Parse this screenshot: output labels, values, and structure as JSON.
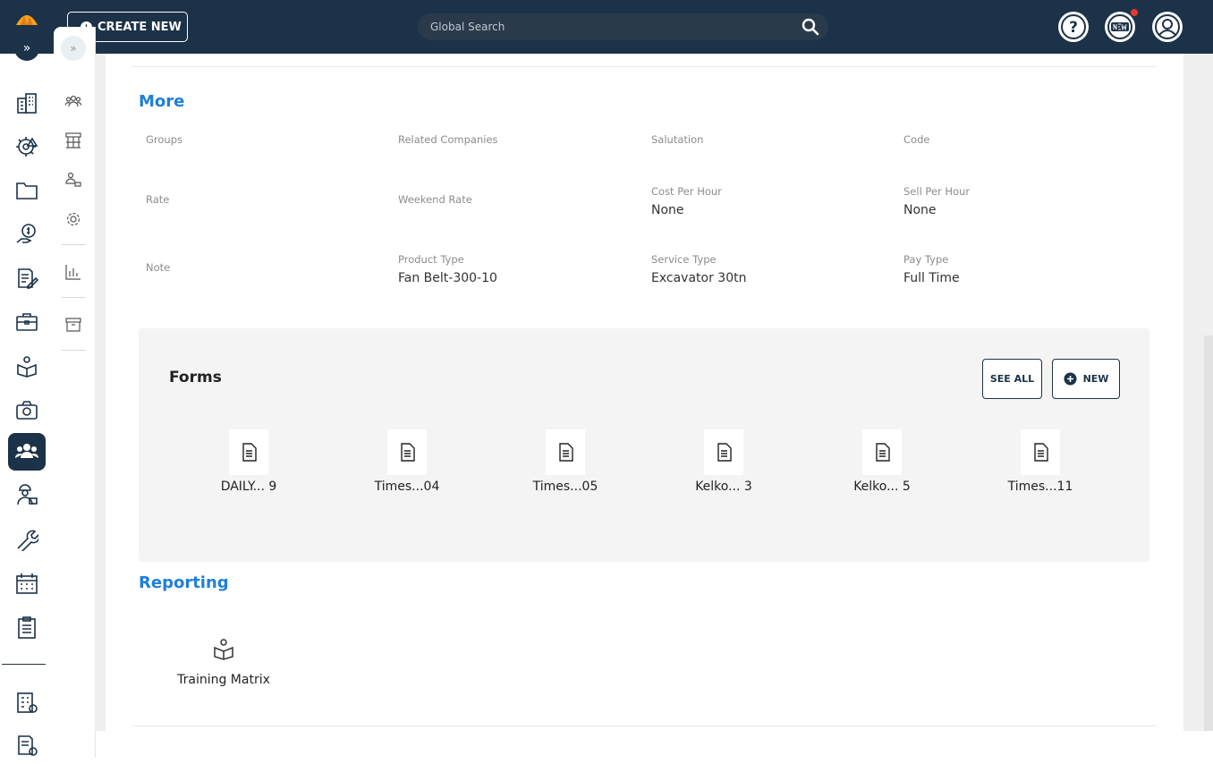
{
  "header": {
    "create_label": "CREATE NEW",
    "search_placeholder": "Global Search",
    "icons": [
      "help-icon",
      "new-features-icon",
      "user-profile-icon"
    ]
  },
  "colors": {
    "nav": "#1c3248",
    "accent": "#1e7fd9",
    "alert": "#e53935"
  },
  "sidebar": {
    "items": [
      "building-icon",
      "alert-gear-icon",
      "folder-icon",
      "money-icon",
      "edit-document-icon",
      "briefcase-icon",
      "training-icon",
      "camera-icon",
      "people-icon",
      "worker-icon",
      "wrench-icon",
      "calendar-icon",
      "clipboard-icon",
      "building-settings-icon",
      "report-settings-icon"
    ],
    "active": "people-icon"
  },
  "flyout": {
    "items": [
      "group-icon",
      "org-chart-icon",
      "hierarchy-icon",
      "settings-icon",
      "chart-icon",
      "archive-icon"
    ]
  },
  "more": {
    "title": "More",
    "fields": [
      {
        "label": "Groups",
        "value": ""
      },
      {
        "label": "Related Companies",
        "value": ""
      },
      {
        "label": "Salutation",
        "value": ""
      },
      {
        "label": "Code",
        "value": ""
      },
      {
        "label": "Rate",
        "value": ""
      },
      {
        "label": "Weekend Rate",
        "value": ""
      },
      {
        "label": "Cost Per Hour",
        "value": "None"
      },
      {
        "label": "Sell Per Hour",
        "value": "None"
      },
      {
        "label": "Note",
        "value": ""
      },
      {
        "label": "Product Type",
        "value": "Fan Belt-300-10"
      },
      {
        "label": "Service Type",
        "value": "Excavator 30tn"
      },
      {
        "label": "Pay Type",
        "value": "Full Time"
      }
    ]
  },
  "forms": {
    "title": "Forms",
    "see_all_label": "SEE ALL",
    "new_label": "NEW",
    "items": [
      "DAILY... 9",
      "Times...04",
      "Times...05",
      "Kelko... 3",
      "Kelko... 5",
      "Times...11"
    ]
  },
  "reporting": {
    "title": "Reporting",
    "items": [
      "Training Matrix"
    ]
  }
}
